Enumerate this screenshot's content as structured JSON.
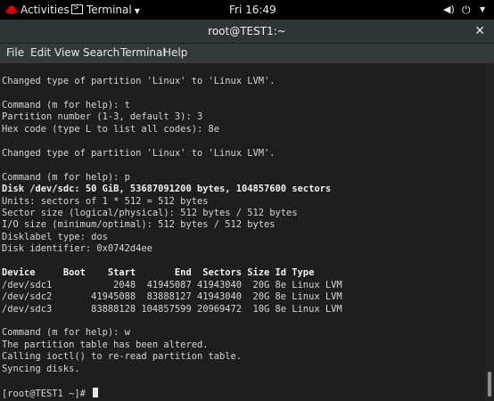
{
  "topbar": {
    "activities": "Activities",
    "app_menu": "Terminal",
    "clock": "Fri 16:49"
  },
  "window": {
    "title": "root@TEST1:~"
  },
  "menu": [
    "File",
    "Edit",
    "View",
    "Search",
    "Terminal",
    "Help"
  ],
  "terminal": {
    "lines": [
      "Changed type of partition 'Linux' to 'Linux LVM'.",
      "",
      "Command (m for help): t",
      "Partition number (1-3, default 3): 3",
      "Hex code (type L to list all codes): 8e",
      "",
      "Changed type of partition 'Linux' to 'Linux LVM'.",
      "",
      "Command (m for help): p",
      "Disk /dev/sdc: 50 GiB, 53687091200 bytes, 104857600 sectors",
      "Units: sectors of 1 * 512 = 512 bytes",
      "Sector size (logical/physical): 512 bytes / 512 bytes",
      "I/O size (minimum/optimal): 512 bytes / 512 bytes",
      "Disklabel type: dos",
      "Disk identifier: 0x0742d4ee",
      "",
      "Device     Boot    Start       End  Sectors Size Id Type",
      "/dev/sdc1           2048  41945087 41943040  20G 8e Linux LVM",
      "/dev/sdc2       41945088  83888127 41943040  20G 8e Linux LVM",
      "/dev/sdc3       83888128 104857599 20969472  10G 8e Linux LVM",
      "",
      "Command (m for help): w",
      "The partition table has been altered.",
      "Calling ioctl() to re-read partition table.",
      "Syncing disks.",
      "",
      "[root@TEST1 ~]# "
    ],
    "bold_lines": [
      9,
      16
    ]
  }
}
